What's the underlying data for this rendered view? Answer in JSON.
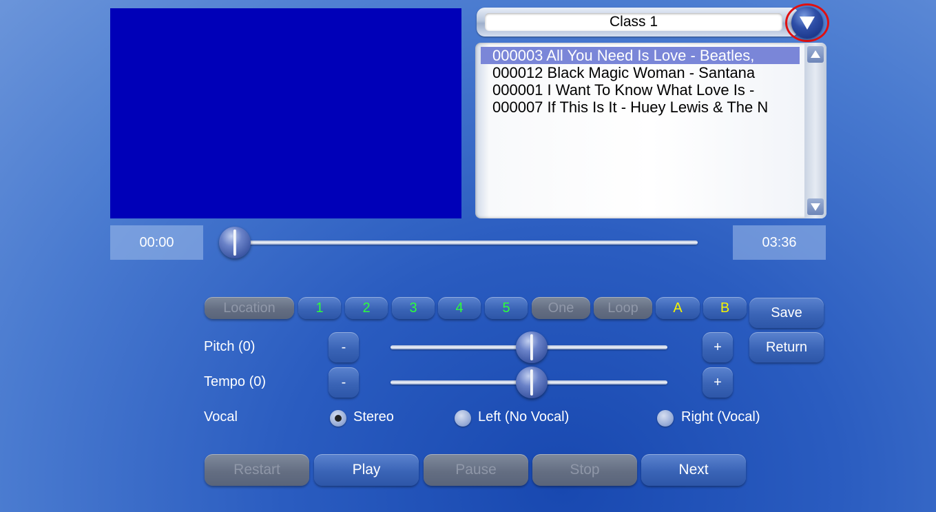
{
  "class_select": {
    "value": "Class 1"
  },
  "songs": [
    {
      "text": "000003 All You Need Is Love - Beatles,",
      "selected": true
    },
    {
      "text": "000012 Black Magic Woman - Santana",
      "selected": false
    },
    {
      "text": "000001 I Want To Know What Love Is -",
      "selected": false
    },
    {
      "text": "000007 If This Is It - Huey Lewis & The N",
      "selected": false
    }
  ],
  "playback": {
    "elapsed": "00:00",
    "total": "03:36",
    "progress": 0
  },
  "location_row": {
    "location": "Location",
    "b1": "1",
    "b2": "2",
    "b3": "3",
    "b4": "4",
    "b5": "5",
    "one": "One",
    "loop": "Loop",
    "a": "A",
    "b": "B"
  },
  "side_buttons": {
    "save": "Save",
    "return": "Return"
  },
  "pitch": {
    "label": "Pitch (0)",
    "minus": "-",
    "plus": "+",
    "value": 0
  },
  "tempo": {
    "label": "Tempo (0)",
    "minus": "-",
    "plus": "+",
    "value": 0
  },
  "vocal": {
    "label": "Vocal",
    "stereo": "Stereo",
    "left": "Left (No Vocal)",
    "right": "Right (Vocal)",
    "selected": "stereo"
  },
  "transport": {
    "restart": "Restart",
    "play": "Play",
    "pause": "Pause",
    "stop": "Stop",
    "next": "Next"
  },
  "colors": {
    "video_bg": "#0000b8",
    "selected_row": "#7a86d8",
    "number_green": "#2cff3a",
    "ab_yellow": "#f6f400"
  }
}
